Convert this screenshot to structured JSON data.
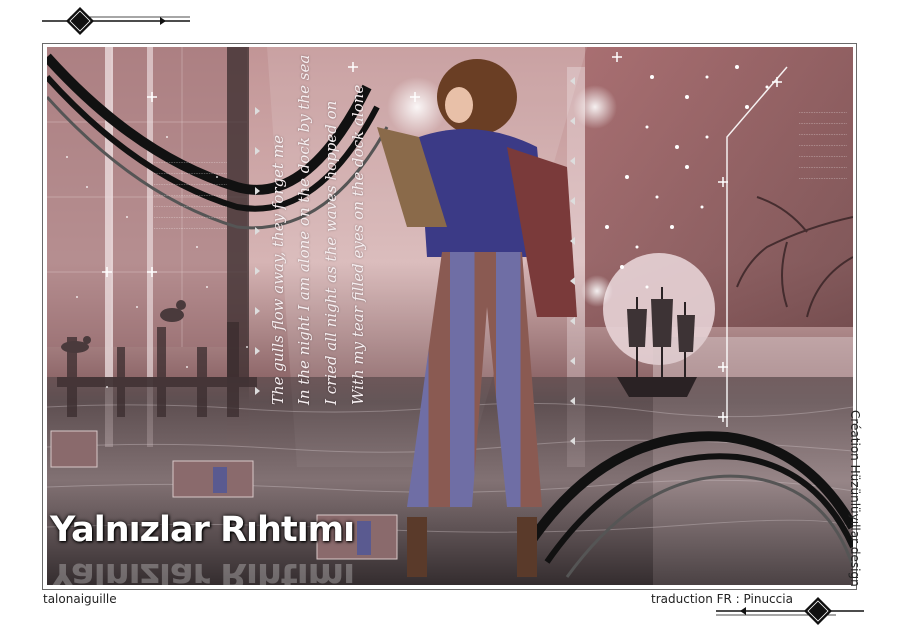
{
  "artwork": {
    "title": "Yalnızlar Rıhtımı",
    "poem_lines": [
      "The gulls flow away, they forget me",
      "In the night I am alone on the dock by the sea",
      "I cried all night as the waves hopped on",
      "With my tear filled eyes on the dock alone"
    ]
  },
  "credits": {
    "designer": "Création Hüzünlüyıllar design",
    "author": "talonaiguille",
    "translation": "traduction FR : Pinuccia"
  },
  "colors": {
    "rose": "#b98a8c",
    "dark": "#2c2628",
    "frame": "#6a6a6a"
  }
}
